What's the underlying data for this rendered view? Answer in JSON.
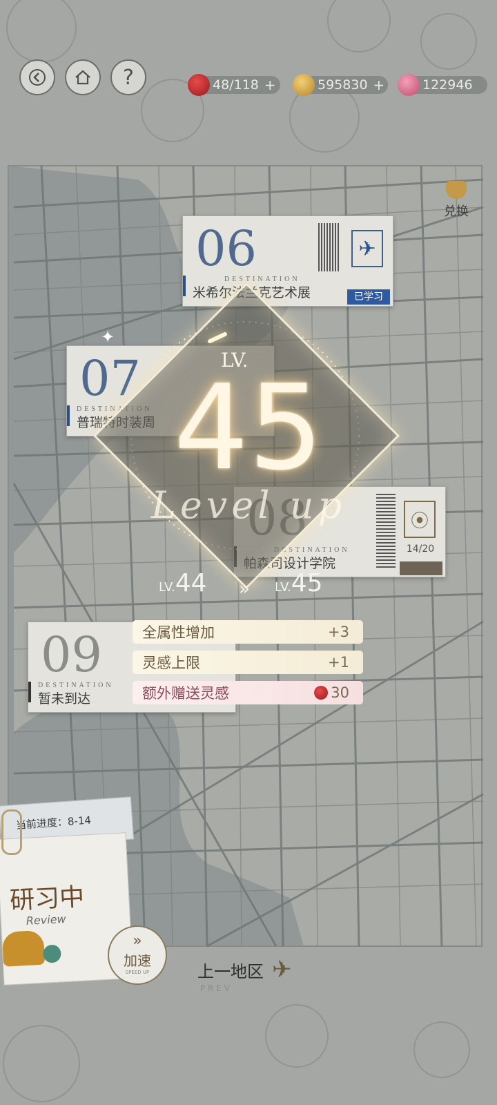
{
  "topbar": {
    "resources": [
      {
        "icon": "apple-icon",
        "value": "48/118",
        "color": "#b8202a"
      },
      {
        "icon": "gold-coin-icon",
        "value": "595830",
        "color": "#c89a3a"
      },
      {
        "icon": "pink-gem-icon",
        "value": "122946",
        "color": "#d96b8a"
      }
    ],
    "help_label": "?"
  },
  "exchange_label": "兑换",
  "cards": {
    "c06": {
      "num": "06",
      "dest": "DESTINATION",
      "name": "米希尔法兰克艺术展",
      "status": "已学习"
    },
    "c07": {
      "num": "07",
      "dest": "DESTINATION",
      "name": "普瑞特时装周"
    },
    "c08": {
      "num": "08",
      "dest": "DESTINATION",
      "name": "帕森司设计学院",
      "progress": "14/20"
    },
    "c09": {
      "num": "09",
      "dest": "DESTINATION",
      "name": "暂未到达"
    }
  },
  "levelup": {
    "lv_tag": "LV.",
    "level": "45",
    "script_text": "Level up",
    "from_prefix": "LV.",
    "from": "44",
    "arrow": "»",
    "to_prefix": "LV.",
    "to": "45",
    "bonuses": [
      {
        "label": "全属性增加",
        "value": "+3"
      },
      {
        "label": "灵感上限",
        "value": "+1"
      },
      {
        "label": "额外赠送灵感",
        "value": "30"
      }
    ]
  },
  "progress_note": {
    "label": "当前进度：8-14",
    "title": "研习中",
    "subtitle": "Review",
    "speed_label": "加速",
    "speed_sub": "SPEED UP"
  },
  "prev": {
    "label": "上一地区",
    "sub": "P R E V"
  }
}
